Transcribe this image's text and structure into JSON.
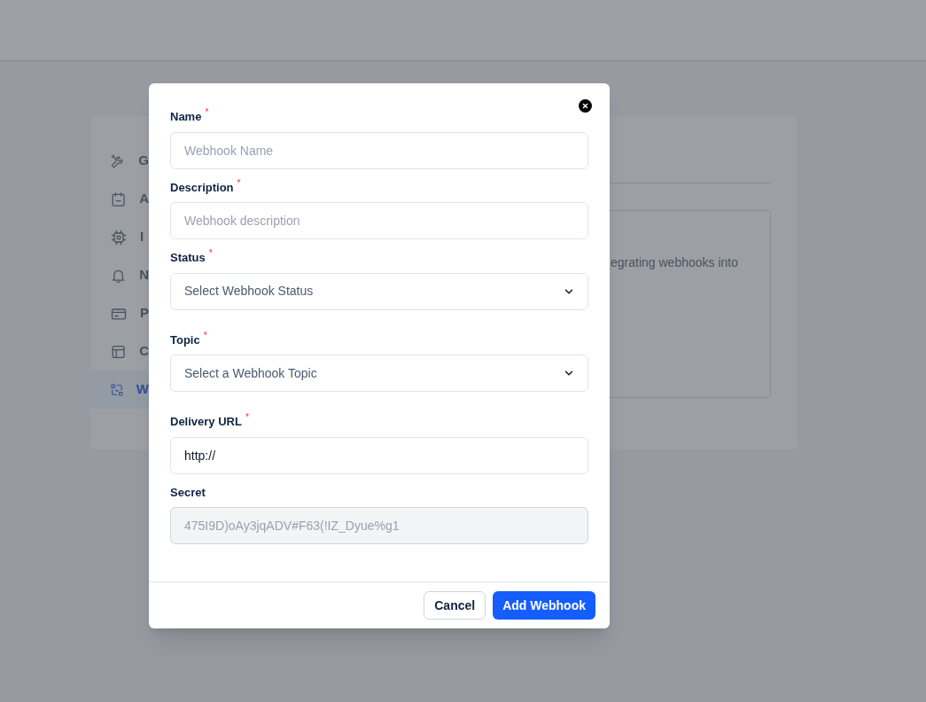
{
  "background": {
    "sidebar": [
      {
        "label": "G",
        "selected": false
      },
      {
        "label": "A",
        "selected": false
      },
      {
        "label": "I",
        "selected": false
      },
      {
        "label": "N",
        "selected": false
      },
      {
        "label": "P",
        "selected": false
      },
      {
        "label": "C",
        "selected": false
      },
      {
        "label": "W",
        "selected": true
      }
    ],
    "content_text": "egrating webhooks into"
  },
  "dialog": {
    "required_mark": "*",
    "fields": [
      {
        "label": "Name",
        "required": true,
        "kind": "input",
        "placeholder": "Webhook Name"
      },
      {
        "label": "Description",
        "required": true,
        "kind": "input",
        "placeholder": "Webhook description"
      },
      {
        "label": "Status",
        "required": true,
        "kind": "select",
        "value": "Select Webhook Status"
      },
      {
        "label": "Topic",
        "required": true,
        "kind": "select",
        "value": "Select a Webhook Topic"
      },
      {
        "label": "Delivery URL",
        "required": true,
        "kind": "input",
        "value": "http://"
      },
      {
        "label": "Secret",
        "required": false,
        "kind": "input",
        "value": "475I9D)oAy3jqADV#F63(!IZ_Dyue%g1",
        "disabled": true
      }
    ],
    "buttons": [
      {
        "label": "Cancel",
        "kind": "secondary"
      },
      {
        "label": "Add Webhook",
        "kind": "primary"
      }
    ]
  }
}
